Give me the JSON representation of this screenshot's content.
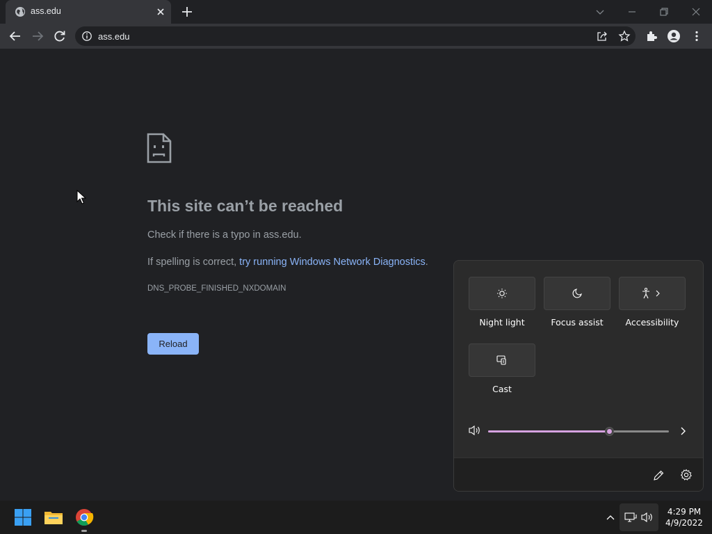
{
  "browser": {
    "tab": {
      "title": "ass.edu",
      "favicon": "globe-icon"
    },
    "address_bar": {
      "url": "ass.edu",
      "icon": "info-icon"
    }
  },
  "error_page": {
    "icon": "sad-document-icon",
    "title": "This site can’t be reached",
    "line1": "Check if there is a typo in ass.edu.",
    "line2_prefix": "If spelling is correct, ",
    "line2_link": "try running Windows Network Diagnostics",
    "line2_suffix": ".",
    "error_code": "DNS_PROBE_FINISHED_NXDOMAIN",
    "reload_label": "Reload"
  },
  "quick_settings": {
    "tiles": [
      {
        "label": "Night light",
        "icon": "brightness-icon"
      },
      {
        "label": "Focus assist",
        "icon": "moon-icon"
      },
      {
        "label": "Accessibility",
        "icon": "accessibility-icon"
      },
      {
        "label": "Cast",
        "icon": "cast-icon"
      }
    ],
    "volume": {
      "level": 0.67
    },
    "accent_color": "#d6a2e0"
  },
  "taskbar": {
    "apps": [
      "windows-start-icon",
      "file-explorer-icon",
      "chrome-icon"
    ],
    "clock": {
      "time": "4:29 PM",
      "date": "4/9/2022"
    }
  }
}
